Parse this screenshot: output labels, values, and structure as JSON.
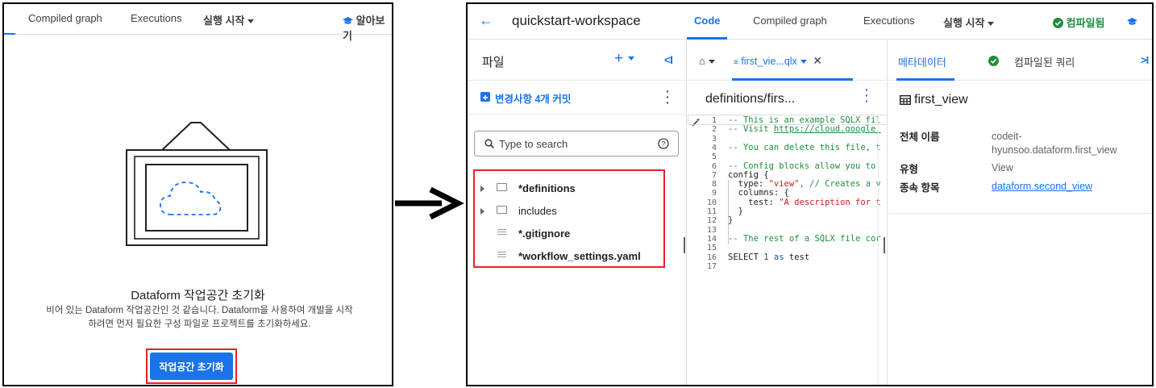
{
  "left": {
    "tabs": {
      "compiled_graph": "Compiled graph",
      "executions": "Executions",
      "start_execution": "실행 시작",
      "learn_more": "알아보기"
    },
    "init": {
      "title": "Dataform 작업공간 초기화",
      "desc_line1": "비어 있는 Dataform 작업공간인 것 같습니다. Dataform을 사용하여 개발을 시작",
      "desc_line2": "하려면 먼저 필요한 구성 파일로 프로젝트를 초기화하세요.",
      "button": "작업공간 초기화"
    }
  },
  "right": {
    "topbar": {
      "workspace_name": "quickstart-workspace",
      "tab_code": "Code",
      "tab_compiled_graph": "Compiled graph",
      "tab_executions": "Executions",
      "start_execution": "실행 시작",
      "compiled_status": "컴파일됨"
    },
    "files": {
      "title": "파일",
      "add": "+",
      "commit_label": "변경사항 4개 커밋",
      "search_placeholder": "Type to search",
      "tree": [
        {
          "name": "*definitions",
          "type": "folder"
        },
        {
          "name": "includes",
          "type": "folder"
        },
        {
          "name": "*.gitignore",
          "type": "file"
        },
        {
          "name": "*workflow_settings.yaml",
          "type": "file"
        }
      ]
    },
    "editor": {
      "tab_label": "first_vie...qlx",
      "path": "definitions/firs...",
      "lines": [
        {
          "n": "1",
          "text": "-- This is an example SQLX fil"
        },
        {
          "n": "2",
          "pre": "-- Visit ",
          "link": "https://cloud.google."
        },
        {
          "n": "3",
          "text": ""
        },
        {
          "n": "4",
          "text": "-- You can delete this file, t"
        },
        {
          "n": "5",
          "text": ""
        },
        {
          "n": "6",
          "text": "-- Config blocks allow you to"
        },
        {
          "n": "7",
          "text": "config {"
        },
        {
          "n": "8",
          "a": "  type: ",
          "s": "\"view\"",
          "b": ", // Creates a v"
        },
        {
          "n": "9",
          "text": "  columns: {"
        },
        {
          "n": "10",
          "a": "    test: ",
          "s": "\"A description for t"
        },
        {
          "n": "11",
          "text": "  }"
        },
        {
          "n": "12",
          "text": "}"
        },
        {
          "n": "13",
          "text": ""
        },
        {
          "n": "14",
          "text": "-- The rest of a SQLX file cor"
        },
        {
          "n": "15",
          "text": ""
        },
        {
          "n": "16",
          "a": "SELECT ",
          "k": "1",
          "m": " as ",
          "z": "test"
        },
        {
          "n": "17",
          "text": ""
        }
      ]
    },
    "meta": {
      "tab_metadata": "메타데이터",
      "tab_compiled_query": "컴파일된 쿼리",
      "view_name": "first_view",
      "full_name_label": "전체 이름",
      "full_name_value_1": "codeit-",
      "full_name_value_2": "hyunsoo.dataform.first_view",
      "type_label": "유형",
      "type_value": "View",
      "deps_label": "종속 항목",
      "deps_value": "dataform.second_view"
    }
  },
  "colors": {
    "accent": "#1a73e8",
    "highlight": "#e8212a",
    "success": "#1e8e3e"
  }
}
